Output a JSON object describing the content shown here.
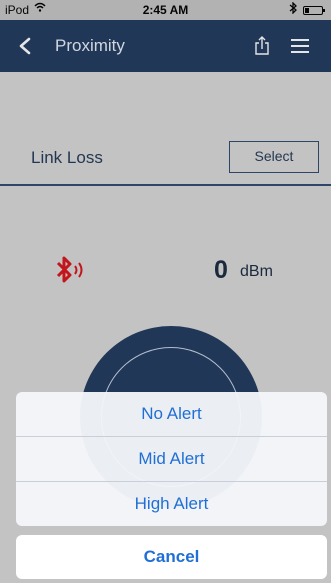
{
  "status_bar": {
    "carrier": "iPod",
    "time": "2:45 AM",
    "wifi_icon": "wifi-icon",
    "bluetooth_icon": "bluetooth-icon",
    "battery_icon": "battery-low-icon"
  },
  "nav": {
    "title": "Proximity",
    "back_icon": "chevron-left-icon",
    "share_icon": "share-icon",
    "menu_icon": "hamburger-menu-icon"
  },
  "link_loss": {
    "label": "Link Loss",
    "select_label": "Select"
  },
  "signal": {
    "icon": "bluetooth-signal-icon",
    "icon_color": "#d9141b",
    "value": "0",
    "unit": "dBm"
  },
  "action_sheet": {
    "options": [
      "No Alert",
      "Mid Alert",
      "High Alert"
    ],
    "cancel_label": "Cancel",
    "accent_color": "#1f6fd6"
  },
  "colors": {
    "nav_background": "#1f3a5f",
    "content_background": "#d9d9d9"
  }
}
